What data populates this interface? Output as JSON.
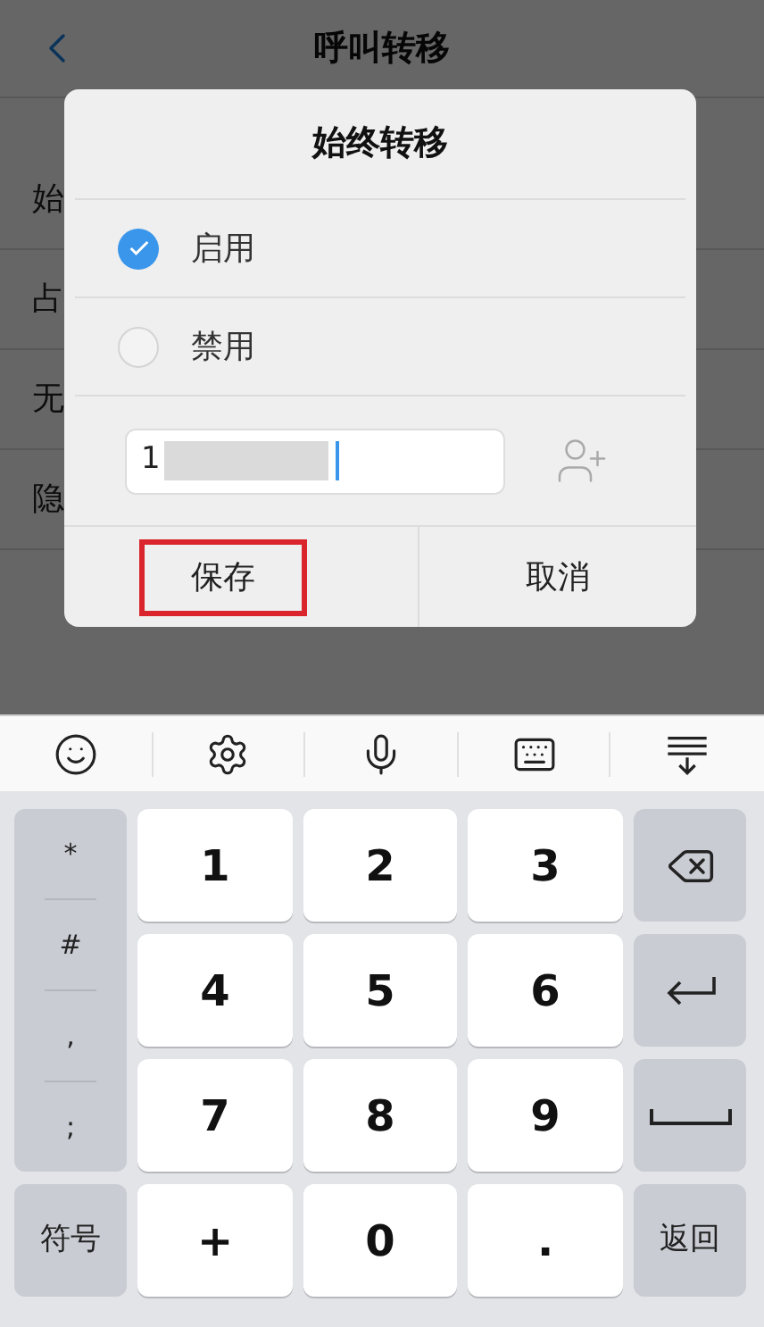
{
  "header": {
    "title": "呼叫转移"
  },
  "list_items": [
    "始",
    "占",
    "无",
    "隐"
  ],
  "dialog": {
    "title": "始终转移",
    "options": [
      {
        "label": "启用",
        "selected": true
      },
      {
        "label": "禁用",
        "selected": false
      }
    ],
    "number_field": {
      "value": "1"
    },
    "buttons": [
      {
        "label": "保存",
        "highlighted": true
      },
      {
        "label": "取消",
        "highlighted": false
      }
    ]
  },
  "keyboard": {
    "symbol_keys": [
      "*",
      "#",
      ",",
      ";"
    ],
    "digit_keys": [
      "1",
      "2",
      "3",
      "4",
      "5",
      "6",
      "7",
      "8",
      "9",
      "+",
      "0",
      "."
    ],
    "switch_key": "符号",
    "return_key": "返回"
  }
}
